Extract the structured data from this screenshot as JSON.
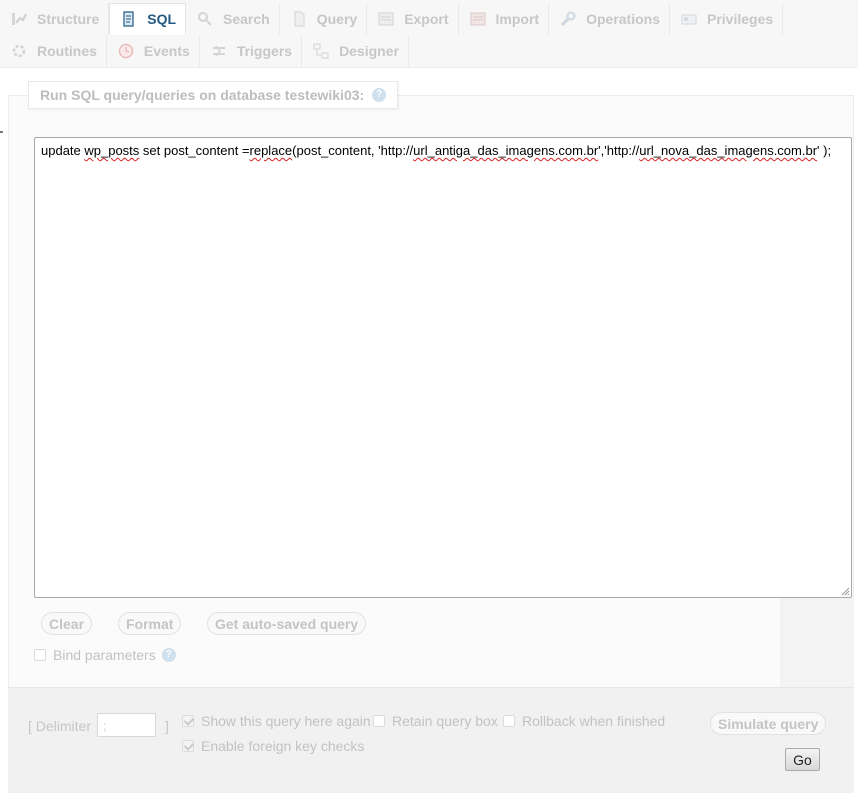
{
  "tabs": {
    "row1": [
      {
        "label": "Structure",
        "icon": "structure-icon",
        "active": false
      },
      {
        "label": "SQL",
        "icon": "sql-icon",
        "active": true
      },
      {
        "label": "Search",
        "icon": "search-icon",
        "active": false
      },
      {
        "label": "Query",
        "icon": "query-icon",
        "active": false
      },
      {
        "label": "Export",
        "icon": "export-icon",
        "active": false
      },
      {
        "label": "Import",
        "icon": "import-icon",
        "active": false
      },
      {
        "label": "Operations",
        "icon": "wrench-icon",
        "active": false
      },
      {
        "label": "Privileges",
        "icon": "privileges-icon",
        "active": false
      }
    ],
    "row2": [
      {
        "label": "Routines",
        "icon": "routines-icon",
        "active": false
      },
      {
        "label": "Events",
        "icon": "clock-icon",
        "active": false
      },
      {
        "label": "Triggers",
        "icon": "triggers-icon",
        "active": false
      },
      {
        "label": "Designer",
        "icon": "designer-icon",
        "active": false
      }
    ]
  },
  "panel": {
    "legend": "Run SQL query/queries on database testewiki03:",
    "sql_parts": {
      "p1": "update ",
      "p2": "wp_posts",
      "p3": " set post_content =",
      "p4": "replace",
      "p5": "(post_content, 'http://",
      "p6": "url_antiga_das_imagens.com.br",
      "p7": "','http://",
      "p8": "url_nova_das_imagens.com.br",
      "p9": "' );"
    }
  },
  "buttons": {
    "clear": "Clear",
    "format": "Format",
    "autosaved": "Get auto-saved query",
    "simulate": "Simulate query",
    "go": "Go"
  },
  "options": {
    "bind_parameters": {
      "label": "Bind parameters",
      "checked": false
    },
    "show_query": {
      "label": "Show this query here again",
      "checked": true
    },
    "retain_box": {
      "label": "Retain query box",
      "checked": false
    },
    "rollback": {
      "label": "Rollback when finished",
      "checked": false
    },
    "foreign_keys": {
      "label": "Enable foreign key checks",
      "checked": true
    }
  },
  "delimiter": {
    "label": "[ Delimiter",
    "close": "]",
    "value": ";"
  },
  "colors": {
    "active_tab_text": "#235a81",
    "inactive_text": "#c7c7c7",
    "spellcheck_underline": "#e02020"
  }
}
